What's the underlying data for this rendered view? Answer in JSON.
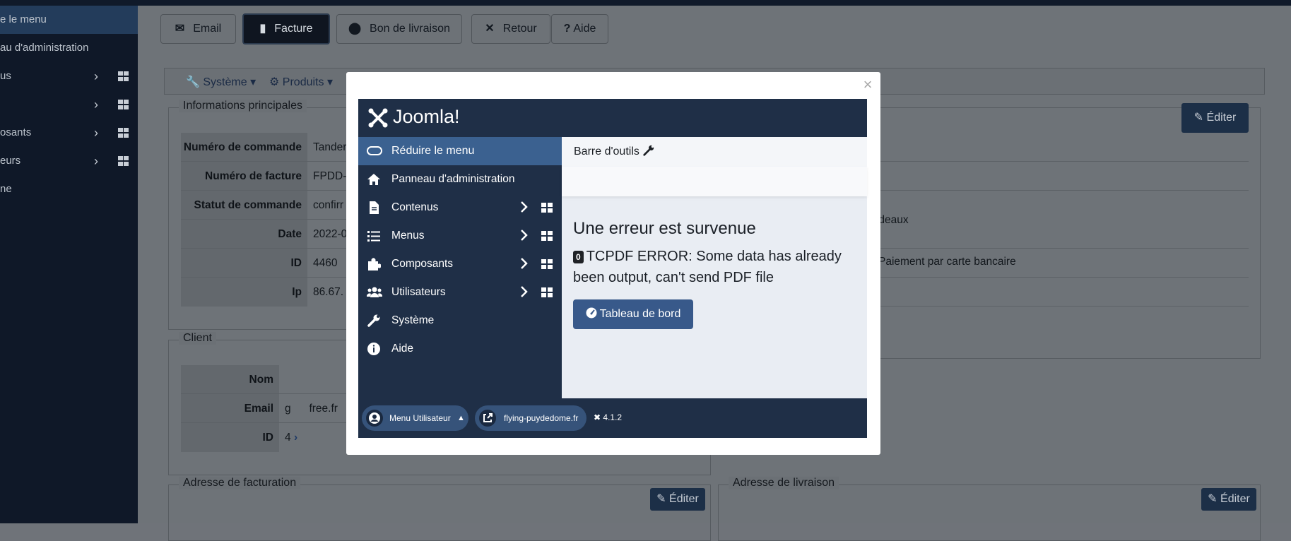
{
  "background": {
    "sidebar": {
      "items": [
        {
          "label": "e le menu"
        },
        {
          "label": "au d'administration"
        },
        {
          "label": "us"
        },
        {
          "label": ""
        },
        {
          "label": "osants"
        },
        {
          "label": "eurs"
        },
        {
          "label": "ne"
        }
      ]
    },
    "toolbar": {
      "email": "Email",
      "facture": "Facture",
      "bon_livraison": "Bon de livraison",
      "retour": "Retour",
      "aide": "Aide"
    },
    "menubar": {
      "systeme": "Système",
      "produits": "Produits"
    },
    "main_info": {
      "legend": "Informations principales",
      "rows": [
        {
          "label": "Numéro de commande",
          "value": "Tander"
        },
        {
          "label": "Numéro de facture",
          "value": "FPDD-"
        },
        {
          "label": "Statut de commande",
          "value": "confirr"
        },
        {
          "label": "Date",
          "value": "2022-0"
        },
        {
          "label": "ID",
          "value": "4460"
        },
        {
          "label": "Ip",
          "value": "86.67."
        }
      ]
    },
    "right_panel": {
      "edit": "Éditer",
      "value_cadeaux": "cadeaux",
      "value_payment": "Paiement par carte bancaire"
    },
    "client": {
      "legend": "Client",
      "rows": [
        {
          "label": "Nom",
          "value": ""
        },
        {
          "label": "Email",
          "value": "g      free.fr"
        },
        {
          "label": "ID",
          "value": "4"
        }
      ]
    },
    "billing": {
      "legend": "Adresse de facturation",
      "edit": "Éditer"
    },
    "shipping": {
      "legend": "Adresse de livraison",
      "edit": "Éditer"
    }
  },
  "modal": {
    "close": "×",
    "logo_text": "Joomla!",
    "menu": {
      "reduce": "Réduire le menu",
      "items": [
        {
          "label": "Panneau d'administration",
          "icon": "home-icon"
        },
        {
          "label": "Contenus",
          "icon": "file-icon"
        },
        {
          "label": "Menus",
          "icon": "list-icon"
        },
        {
          "label": "Composants",
          "icon": "puzzle-icon"
        },
        {
          "label": "Utilisateurs",
          "icon": "users-icon"
        },
        {
          "label": "Système",
          "icon": "wrench-icon"
        },
        {
          "label": "Aide",
          "icon": "info-icon"
        }
      ]
    },
    "toolbar_label": "Barre d'outils",
    "error_title": "Une erreur est survenue",
    "error_code": "0",
    "error_message": "TCPDF ERROR: Some data has already been output, can't send PDF file",
    "dashboard_button": "Tableau de bord",
    "footer": {
      "user_menu": "Menu Utilisateur",
      "site_link": "flying-puydedome.fr",
      "version": "4.1.2"
    }
  },
  "colors": {
    "joomla_sidebar": "#1f2f47",
    "joomla_accent": "#3b6190",
    "dashboard_button": "#38598a",
    "content_bg": "#e9edf3"
  }
}
